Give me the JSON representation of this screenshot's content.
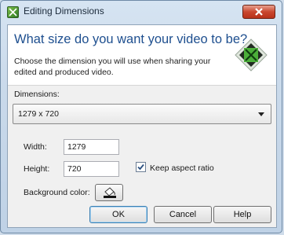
{
  "window": {
    "title": "Editing Dimensions"
  },
  "banner": {
    "headline": "What size do you want your video to be?",
    "subtext": "Choose the dimension you will use when sharing your edited and produced video."
  },
  "dimensions": {
    "label": "Dimensions:",
    "selected": "1279 x 720"
  },
  "width": {
    "label": "Width:",
    "value": "1279"
  },
  "height": {
    "label": "Height:",
    "value": "720"
  },
  "aspect": {
    "label": "Keep aspect ratio",
    "checked": true
  },
  "background": {
    "label": "Background color:"
  },
  "buttons": {
    "ok": "OK",
    "cancel": "Cancel",
    "help": "Help"
  },
  "colors": {
    "accent": "#1e4f8f",
    "close": "#c9472f",
    "icon_green": "#3a9a2b"
  },
  "icons": [
    "app-icon",
    "close-icon",
    "banner-icon",
    "chevron-down-icon",
    "checkmark-icon",
    "paint-bucket-icon"
  ]
}
